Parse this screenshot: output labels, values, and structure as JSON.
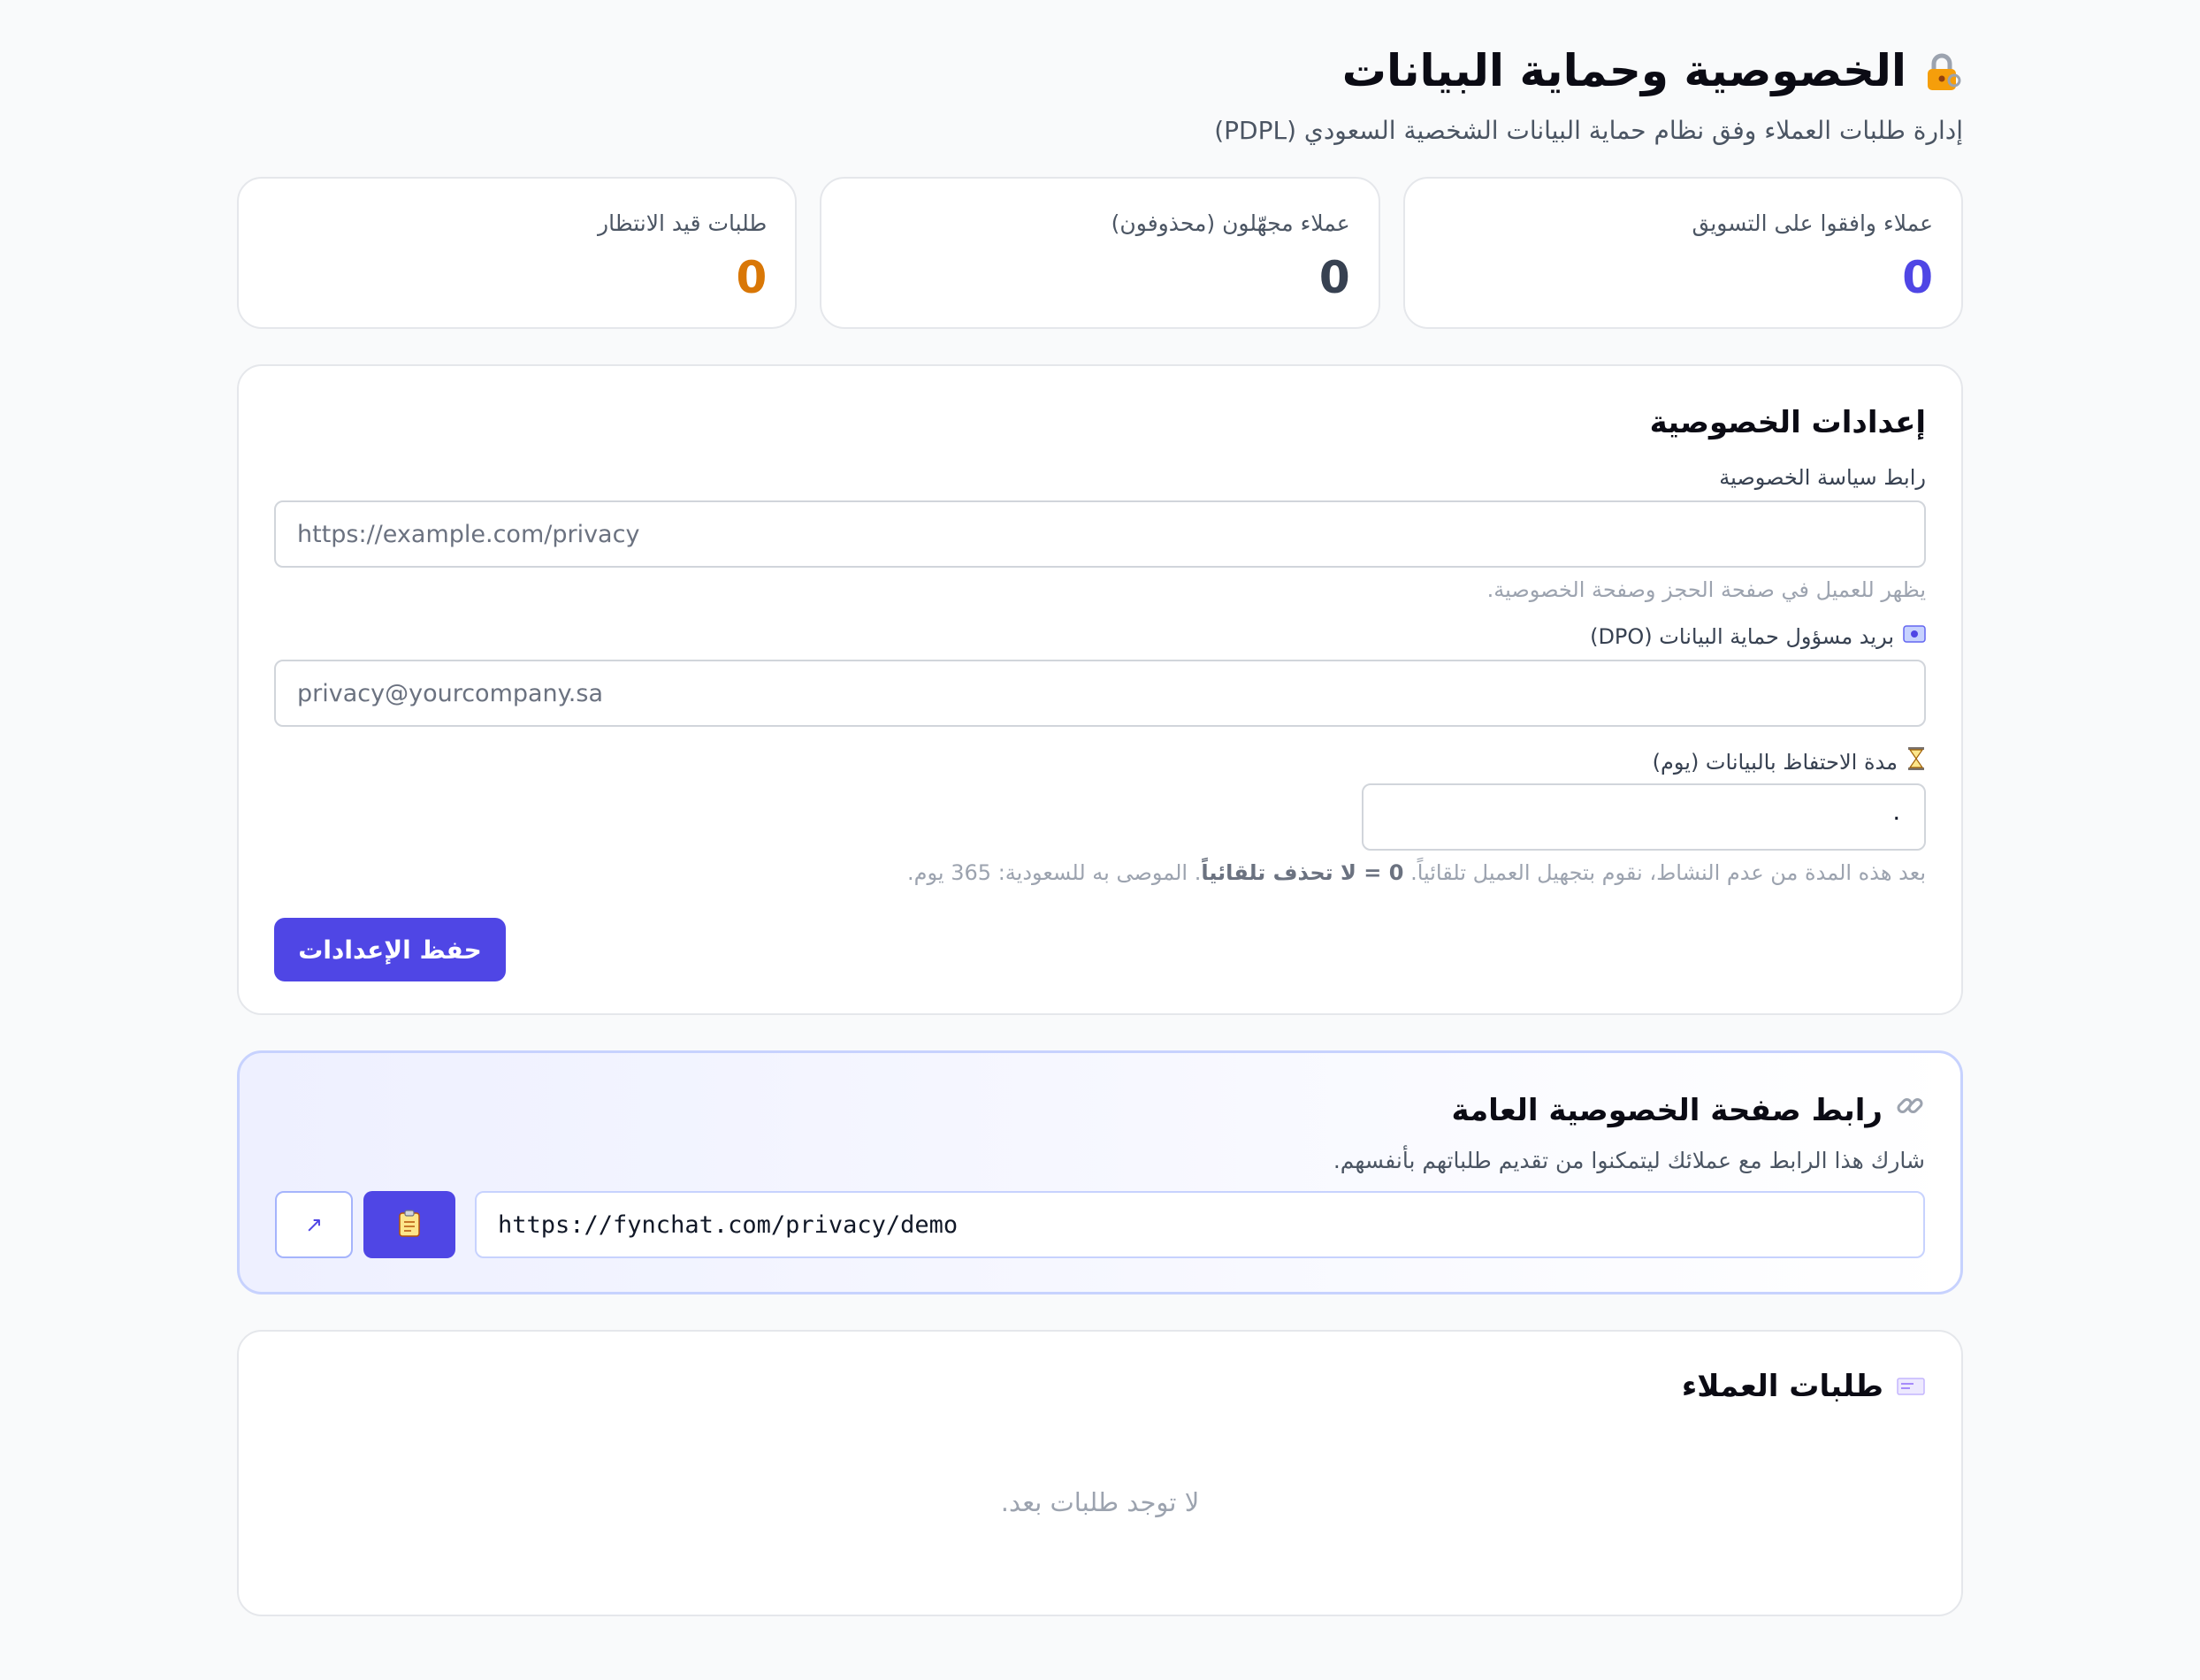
{
  "header": {
    "title": "الخصوصية وحماية البيانات",
    "title_icon": "lock-icon",
    "subtitle": "إدارة طلبات العملاء وفق نظام حماية البيانات الشخصية السعودي (PDPL)"
  },
  "stats": [
    {
      "label": "عملاء وافقوا على التسويق",
      "value": "0",
      "color": "#4f46e5"
    },
    {
      "label": "عملاء مجهّلون (محذوفون)",
      "value": "0",
      "color": "#374151"
    },
    {
      "label": "طلبات قيد الانتظار",
      "value": "0",
      "color": "#d97706"
    }
  ],
  "settings": {
    "title": "إعدادات الخصوصية",
    "policy_url": {
      "label": "رابط سياسة الخصوصية",
      "placeholder": "https://example.com/privacy",
      "hint": "يظهر للعميل في صفحة الحجز وصفحة الخصوصية."
    },
    "dpo_email": {
      "label": "بريد مسؤول حماية البيانات (DPO)",
      "icon": "email-icon",
      "placeholder": "privacy@yourcompany.sa"
    },
    "retention": {
      "label": "مدة الاحتفاظ بالبيانات (يوم)",
      "icon": "hourglass-icon",
      "value": "٠",
      "hint_before": "بعد هذه المدة من عدم النشاط، نقوم بتجهيل العميل تلقائياً. ",
      "hint_bold": "0 = لا تحذف تلقائياً",
      "hint_after": ". الموصى به للسعودية: 365 يوم."
    },
    "save_label": "حفظ الإعدادات"
  },
  "public_link": {
    "title": "رابط صفحة الخصوصية العامة",
    "icon": "link-icon",
    "description": "شارك هذا الرابط مع عملائك ليتمكنوا من تقديم طلباتهم بأنفسهم.",
    "url": "https://fynchat.com/privacy/demo",
    "copy_icon": "clipboard-icon",
    "open_icon": "external-link-icon",
    "open_glyph": "↗"
  },
  "requests": {
    "title": "طلبات العملاء",
    "icon": "inbox-icon",
    "empty_text": "لا توجد طلبات بعد."
  },
  "colors": {
    "accent": "#4f46e5",
    "pending": "#d97706",
    "anonymized": "#374151"
  }
}
